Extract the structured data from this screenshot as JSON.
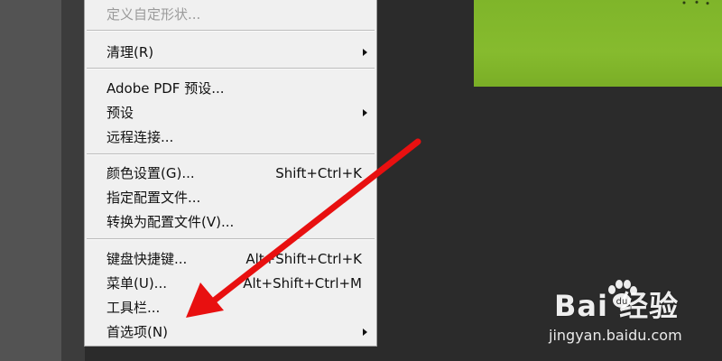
{
  "menu": {
    "items": [
      {
        "label": "定义自定形状...",
        "shortcut": "",
        "submenu": false,
        "disabled": true
      },
      {
        "label": "清理(R)",
        "shortcut": "",
        "submenu": true,
        "disabled": false
      },
      {
        "label": "Adobe PDF 预设...",
        "shortcut": "",
        "submenu": false,
        "disabled": false
      },
      {
        "label": "预设",
        "shortcut": "",
        "submenu": true,
        "disabled": false
      },
      {
        "label": "远程连接...",
        "shortcut": "",
        "submenu": false,
        "disabled": false
      },
      {
        "label": "颜色设置(G)...",
        "shortcut": "Shift+Ctrl+K",
        "submenu": false,
        "disabled": false
      },
      {
        "label": "指定配置文件...",
        "shortcut": "",
        "submenu": false,
        "disabled": false
      },
      {
        "label": "转换为配置文件(V)...",
        "shortcut": "",
        "submenu": false,
        "disabled": false
      },
      {
        "label": "键盘快捷键...",
        "shortcut": "Alt+Shift+Ctrl+K",
        "submenu": false,
        "disabled": false
      },
      {
        "label": "菜单(U)...",
        "shortcut": "Alt+Shift+Ctrl+M",
        "submenu": false,
        "disabled": false
      },
      {
        "label": "工具栏...",
        "shortcut": "",
        "submenu": false,
        "disabled": false
      },
      {
        "label": "首选项(N)",
        "shortcut": "",
        "submenu": true,
        "disabled": false
      }
    ]
  },
  "annotation": {
    "arrow_color": "#e81010",
    "points_to": "工具栏..."
  },
  "watermark": {
    "logo_text": "Bai  经验",
    "url": "jingyan.baidu.com"
  },
  "colors": {
    "menu_bg": "#f0f0f0",
    "workspace_bg": "#2b2b2b",
    "canvas_green": "#86bb2e"
  }
}
